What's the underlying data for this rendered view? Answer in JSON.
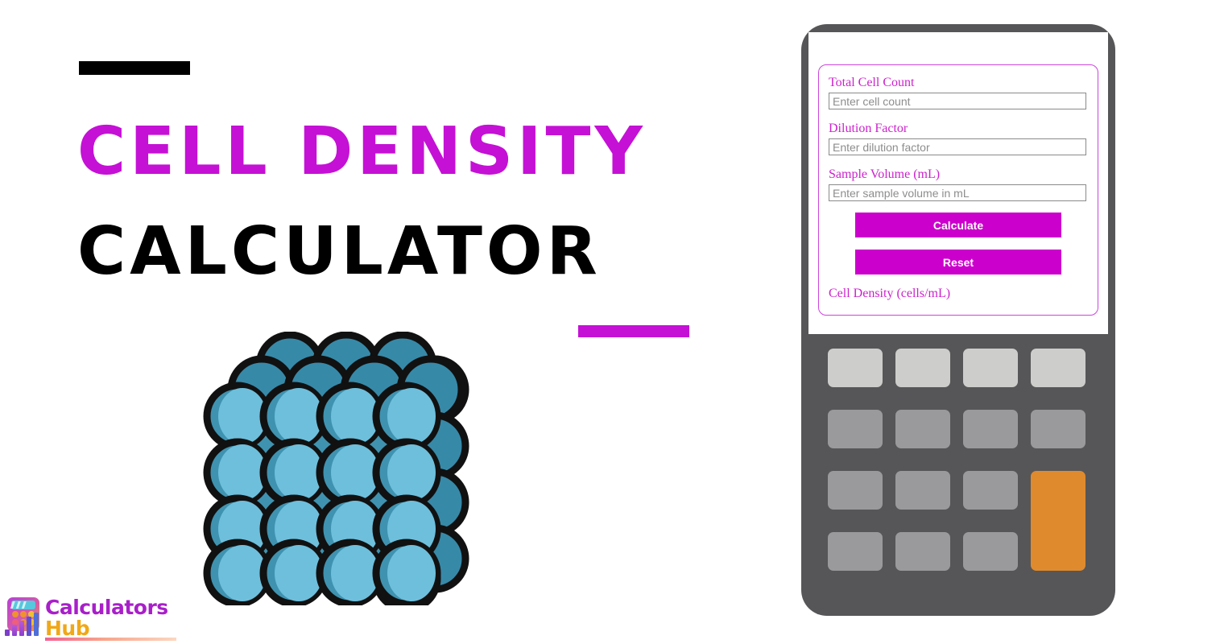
{
  "hero": {
    "accent_dash_color": "#000000",
    "magenta_dash_color": "#c510d6",
    "title_line_1": "CELL DENSITY",
    "title_line_2": "CALCULATOR"
  },
  "illustration": {
    "name": "cell-cluster-cube",
    "front_fill": "#6ebfdc",
    "shade_fill": "#3f93b0",
    "back_fill": "#3789a8",
    "outline": "#111111",
    "front_rows": 4,
    "front_cols": 4
  },
  "device": {
    "body_color": "#565658",
    "screen_color": "#ffffff",
    "accent_color": "#cc00cc",
    "keypad": {
      "rows": [
        {
          "keys": [
            "key-light-1",
            "key-light-2",
            "key-light-3",
            "key-light-4"
          ],
          "style": "light"
        },
        {
          "keys": [
            "key-mid-1",
            "key-mid-2",
            "key-mid-3",
            "key-mid-4"
          ],
          "style": "mid"
        },
        {
          "keys": [
            "key-mid-5",
            "key-mid-6",
            "key-mid-7"
          ],
          "style": "mid"
        },
        {
          "keys": [
            "key-mid-8",
            "key-mid-9",
            "key-mid-10"
          ],
          "style": "mid"
        }
      ],
      "accent_key": "key-equals-orange",
      "light_color": "#cdcdcb",
      "mid_color": "#9a9a9c",
      "accent_color": "#e08a2e"
    }
  },
  "form": {
    "border_color": "#cc44dd",
    "fields": [
      {
        "label": "Total Cell Count",
        "placeholder": "Enter cell count",
        "value": ""
      },
      {
        "label": "Dilution Factor",
        "placeholder": "Enter dilution factor",
        "value": ""
      },
      {
        "label": "Sample Volume (mL)",
        "placeholder": "Enter sample volume in mL",
        "value": ""
      }
    ],
    "calculate_label": "Calculate",
    "reset_label": "Reset",
    "result_label": "Cell Density (cells/mL)"
  },
  "logo": {
    "word_1": "Calculators",
    "word_2": "Hub",
    "word_1_color": "#a81fc9",
    "word_2_color": "#f0a818",
    "mark_name": "calculator-bars-icon"
  }
}
